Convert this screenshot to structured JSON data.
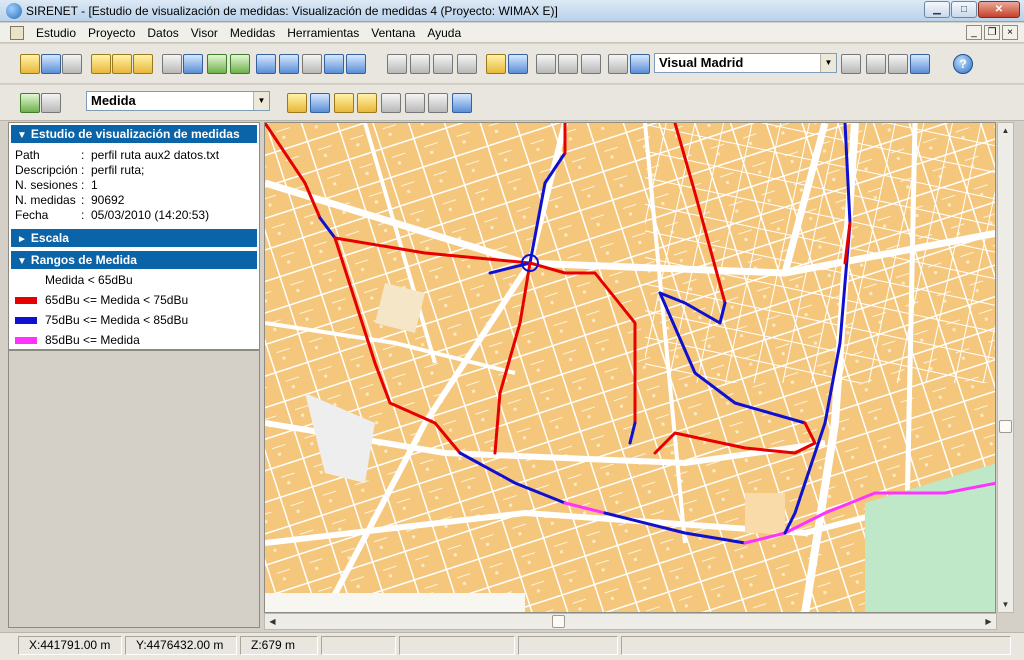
{
  "window": {
    "title": "SIRENET - [Estudio de visualización de medidas: Visualización de medidas 4 (Proyecto: WIMAX E)]",
    "controls": [
      "▁",
      "□",
      "✕"
    ]
  },
  "menu": {
    "items": [
      "Estudio",
      "Proyecto",
      "Datos",
      "Visor",
      "Medidas",
      "Herramientas",
      "Ventana",
      "Ayuda"
    ],
    "mdi_controls": [
      "_",
      "❐",
      "×"
    ]
  },
  "toolbar1": {
    "map_selector": "Visual Madrid",
    "help_label": "?"
  },
  "toolbar2": {
    "layer_selector": "Medida"
  },
  "study_panel": {
    "title": "Estudio de visualización de medidas",
    "rows": [
      {
        "key": "Path",
        "value": "perfil ruta aux2 datos.txt"
      },
      {
        "key": "Descripción",
        "value": "perfil ruta;"
      },
      {
        "key": "N. sesiones",
        "value": "1"
      },
      {
        "key": "N. medidas",
        "value": "90692"
      },
      {
        "key": "Fecha",
        "value": "05/03/2010 (14:20:53)"
      }
    ]
  },
  "scale_panel": {
    "title": "Escala"
  },
  "ranges_panel": {
    "title": "Rangos de Medida",
    "items": [
      {
        "label": "Medida < 65dBu",
        "color": "#ffffff"
      },
      {
        "label": "65dBu <= Medida < 75dBu",
        "color": "#e60000"
      },
      {
        "label": "75dBu <= Medida < 85dBu",
        "color": "#1010d0"
      },
      {
        "label": "85dBu <= Medida",
        "color": "#ff33ff"
      }
    ]
  },
  "status": {
    "x": "X:441791.00 m",
    "y": "Y:4476432.00 m",
    "z": "Z:679 m"
  },
  "colors": {
    "map_block": "#f4c77c",
    "map_street": "#ffffff",
    "park": "#bfe8c8",
    "header_blue": "#0b64a8"
  }
}
